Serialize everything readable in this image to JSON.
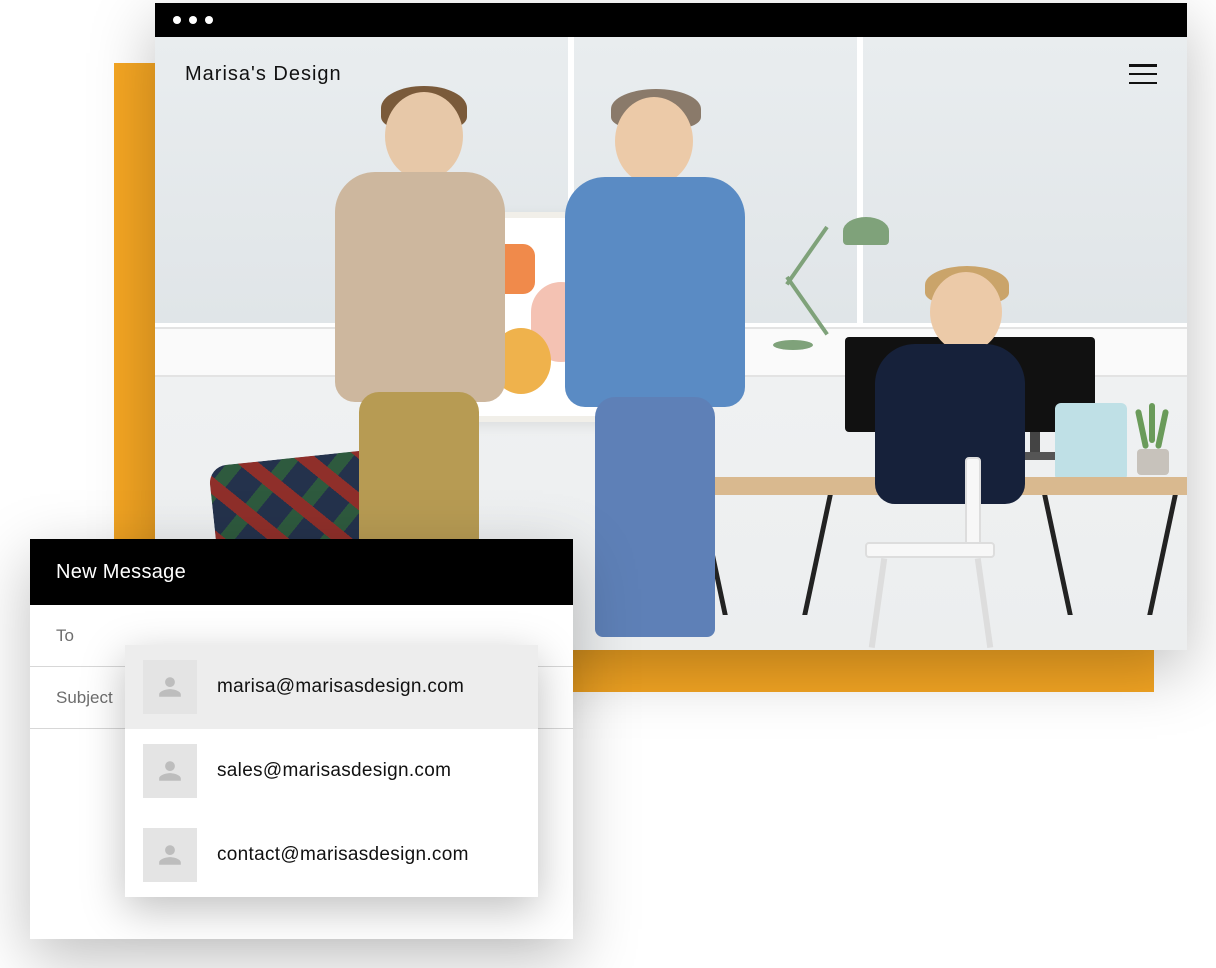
{
  "colors": {
    "accent": "#F5A623"
  },
  "site": {
    "title": "Marisa's Design"
  },
  "compose": {
    "title": "New Message",
    "to_label": "To",
    "subject_label": "Subject",
    "suggestions": [
      {
        "email": "marisa@marisasdesign.com",
        "highlighted": true
      },
      {
        "email": "sales@marisasdesign.com",
        "highlighted": false
      },
      {
        "email": "contact@marisasdesign.com",
        "highlighted": false
      }
    ]
  }
}
